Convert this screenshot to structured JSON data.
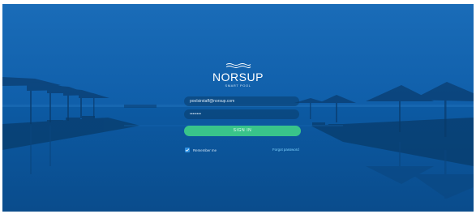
{
  "brand": {
    "name": "NORSUP",
    "tagline": "SMART POOL"
  },
  "login": {
    "email_value": "poolsirstaff@norsup.com",
    "password_value": "••••••••",
    "signin_label": "SIGN IN",
    "remember_label": "Remember me",
    "remember_checked": true,
    "forgot_label": "Forgot password"
  },
  "colors": {
    "overlay": "#0f5fa8",
    "signin": "#39c48a",
    "link": "#7fd3ff",
    "checkbox": "#2f8fe0"
  },
  "icons": {
    "logo": "waves-icon",
    "checkbox": "checkmark-icon"
  }
}
